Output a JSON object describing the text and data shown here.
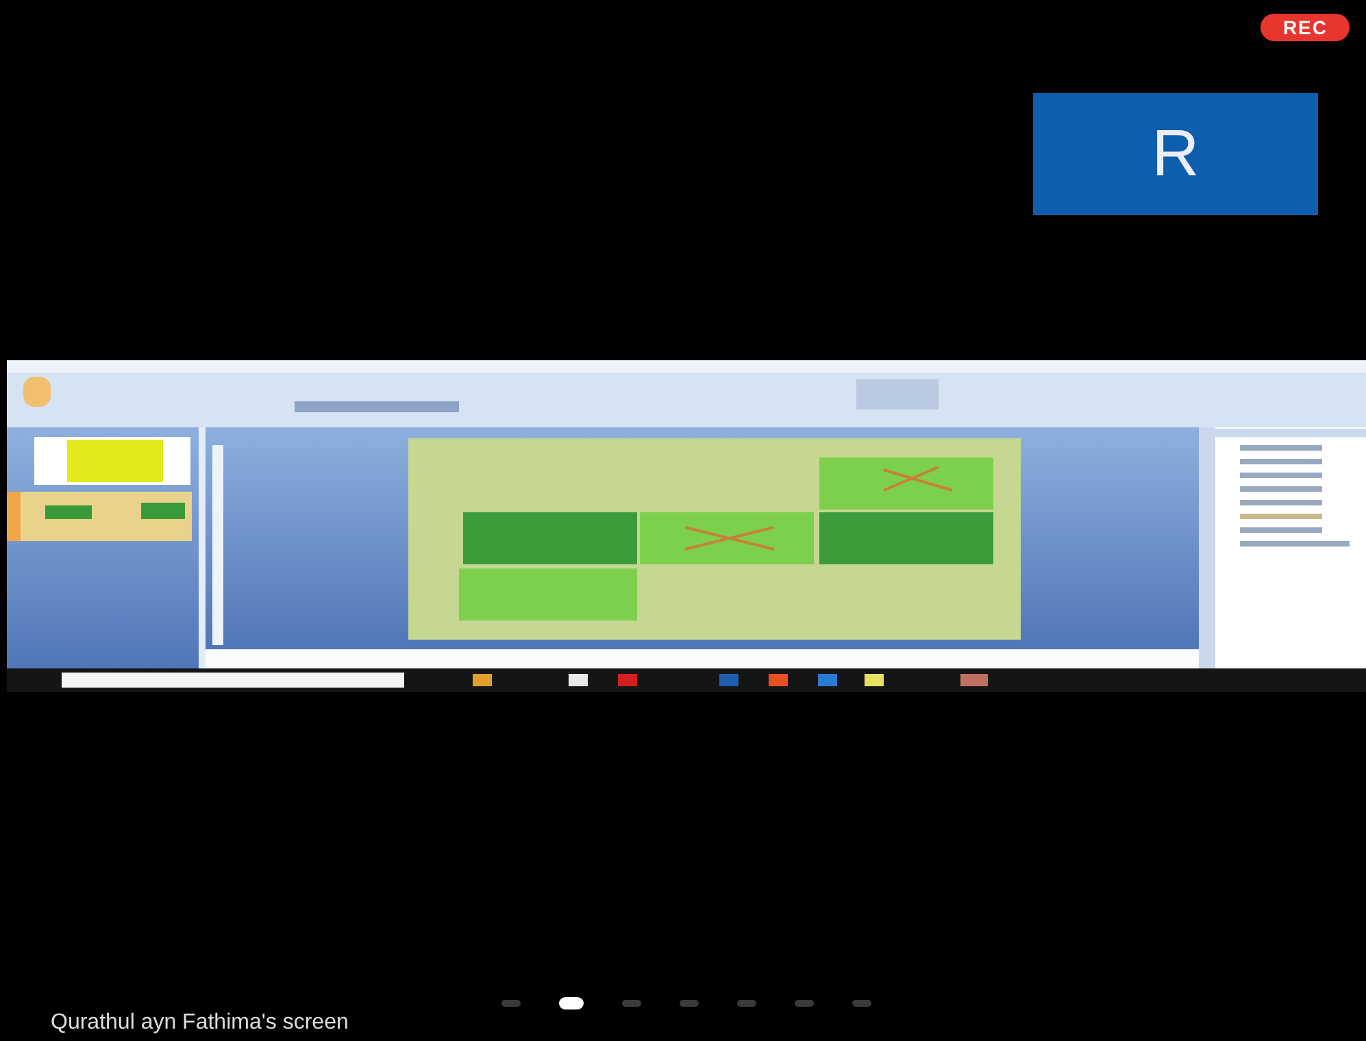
{
  "recording_badge": "REC",
  "participant_tile": {
    "initial": "R"
  },
  "pages": [
    {
      "selected": false
    },
    {
      "selected": true
    },
    {
      "selected": false
    },
    {
      "selected": false
    },
    {
      "selected": false
    },
    {
      "selected": false
    },
    {
      "selected": false
    }
  ],
  "caption": "Qurathul ayn Fathima's screen"
}
